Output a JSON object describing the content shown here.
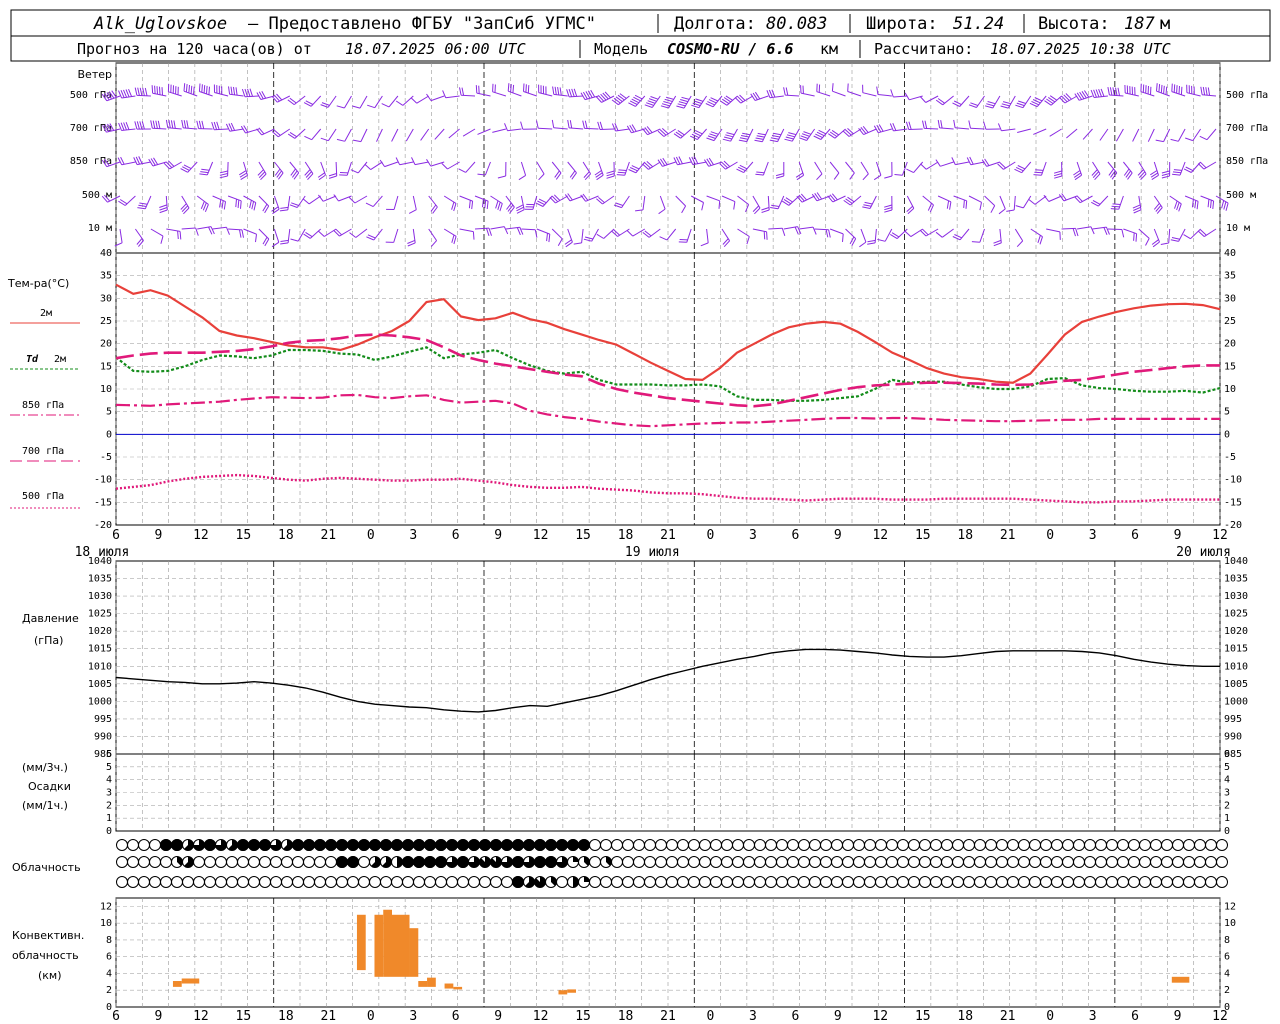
{
  "header": {
    "station": "Alk_Uglovskoe",
    "provider": "– Предоставлено ФГБУ \"ЗапСиб УГМС\"",
    "lon_label": "Долгота:",
    "lon": "80.083",
    "lat_label": "Широта:",
    "lat": "51.24",
    "alt_label": "Высота:",
    "alt": "187",
    "alt_unit": "м",
    "forecast_label": "Прогноз на 120 часа(ов) от",
    "forecast_from": "18.07.2025 06:00 UTC",
    "model_label": "Модель",
    "model": "COSMO-RU / 6.6",
    "model_unit": "км",
    "computed_label": "Рассчитано:",
    "computed": "18.07.2025 10:38 UTC"
  },
  "labels": {
    "wind": "Ветер",
    "levels": [
      "500 гПа",
      "700 гПа",
      "850 гПа",
      "500 м",
      "10 м"
    ],
    "temp": "Тем-ра(°C)",
    "t2m": "2м",
    "td": "Td",
    "td_level": "2м",
    "t850": "850 гПа",
    "t700": "700 гПа",
    "t500": "500 гПа",
    "pressure": "Давление",
    "pressure_unit": "(гПа)",
    "precip_unit3": "(мм/3ч.)",
    "precip": "Осадки",
    "precip_unit1": "(мм/1ч.)",
    "cloud": "Облачность",
    "conv1": "Конвективн.",
    "conv2": "облачность",
    "conv3": "(км)"
  },
  "colors": {
    "t2m": "#e8403a",
    "td": "#138c1a",
    "t850": "#e0197a",
    "wind": "#8a2be2",
    "zero": "#0000cc",
    "pressure": "#000000",
    "conv": "#f0892a"
  },
  "chart_data": {
    "type": "meteogram",
    "x_hours": [
      6,
      9,
      12,
      15,
      18,
      21,
      0,
      3,
      6,
      9,
      12,
      15,
      18,
      21,
      0,
      3,
      6,
      9,
      12,
      15,
      18,
      21,
      0,
      3,
      6,
      9,
      12
    ],
    "day_labels": [
      "18 июля",
      "19 июля",
      "20 июля"
    ],
    "temperature": {
      "ylim": [
        -20,
        40
      ],
      "yticks": [
        40,
        35,
        30,
        25,
        20,
        15,
        10,
        5,
        0,
        -5,
        -10,
        -15,
        -20
      ],
      "series": [
        {
          "name": "2м",
          "values": [
            33,
            31,
            31.8,
            30.6,
            28.2,
            25.8,
            22.8,
            21.8,
            21.2,
            20.4,
            19.6,
            19.2,
            19.2,
            18.6,
            19.8,
            21.4,
            22.8,
            25,
            29.2,
            29.8,
            26,
            25.2,
            25.6,
            26.8,
            25.4,
            24.6,
            23.2,
            22,
            20.8,
            19.8,
            17.8,
            15.8,
            14,
            12.2,
            12,
            14.6,
            18,
            20,
            22,
            23.6,
            24.4,
            24.8,
            24.4,
            22.6,
            20.4,
            18,
            16.4,
            14.6,
            13.4,
            12.6,
            12.2,
            11.6,
            11.4,
            13.4,
            17.6,
            22,
            24.8,
            26,
            27,
            27.8,
            28.4,
            28.7,
            28.8,
            28.5,
            27.6
          ]
        },
        {
          "name": "Td 2м",
          "values": [
            17,
            14,
            13.8,
            14,
            15,
            16.4,
            17.4,
            17.2,
            16.8,
            17.4,
            18.6,
            18.6,
            18.4,
            17.8,
            17.6,
            16.4,
            17.2,
            18.2,
            19.2,
            16.8,
            17.6,
            18,
            18.6,
            16.8,
            15.2,
            14,
            13.4,
            13.8,
            12,
            11,
            11,
            11,
            10.8,
            10.8,
            11,
            10.6,
            8.4,
            7.6,
            7.6,
            7.4,
            7.4,
            7.6,
            8,
            8.4,
            10,
            12,
            11.4,
            11.6,
            11.6,
            11,
            10.4,
            10,
            10,
            10.6,
            12.2,
            12.4,
            10.8,
            10.2,
            10,
            9.6,
            9.4,
            9.4,
            9.6,
            9.2,
            10.2
          ]
        },
        {
          "name": "850 гПа",
          "values": [
            6.5,
            6.4,
            6.3,
            6.6,
            6.8,
            7,
            7.2,
            7.6,
            7.9,
            8.2,
            8.1,
            8,
            8.1,
            8.6,
            8.7,
            8.2,
            8,
            8.4,
            8.6,
            7.6,
            7,
            7.2,
            7.4,
            6.8,
            5.2,
            4.4,
            3.8,
            3.4,
            2.8,
            2.4,
            2,
            1.8,
            2,
            2.2,
            2.4,
            2.5,
            2.6,
            2.6,
            2.8,
            3,
            3.2,
            3.4,
            3.6,
            3.6,
            3.5,
            3.6,
            3.6,
            3.4,
            3.2,
            3.1,
            3,
            2.9,
            2.9,
            3,
            3.1,
            3.2,
            3.2,
            3.4,
            3.4,
            3.4,
            3.4,
            3.4,
            3.4,
            3.4,
            3.4
          ]
        },
        {
          "name": "700 гПа",
          "values": [
            16.8,
            17.4,
            17.8,
            18,
            18,
            18,
            18.2,
            18.4,
            18.8,
            19.4,
            20.2,
            20.6,
            20.8,
            21.2,
            21.8,
            22,
            21.8,
            21.4,
            20.8,
            19.2,
            17.4,
            16.4,
            15.6,
            15,
            14.4,
            13.8,
            13.2,
            12.8,
            11.2,
            10,
            9.2,
            8.6,
            8,
            7.6,
            7.2,
            6.8,
            6.4,
            6.2,
            6.6,
            7.4,
            8.2,
            9,
            9.8,
            10.4,
            10.8,
            11,
            11.2,
            11.4,
            11.4,
            11.3,
            11.2,
            11,
            10.9,
            11,
            11.4,
            11.8,
            12,
            12.6,
            13.2,
            13.8,
            14.2,
            14.6,
            15,
            15.2,
            15.2
          ]
        },
        {
          "name": "500 гПа",
          "values": [
            -12,
            -11.6,
            -11.2,
            -10.4,
            -9.8,
            -9.4,
            -9.2,
            -9,
            -9.2,
            -9.6,
            -10,
            -10.2,
            -9.8,
            -9.6,
            -9.8,
            -10,
            -10.2,
            -10.2,
            -10,
            -10,
            -9.8,
            -10.2,
            -10.6,
            -11.2,
            -11.6,
            -11.8,
            -11.8,
            -11.6,
            -12,
            -12.2,
            -12.4,
            -12.8,
            -13,
            -13,
            -13.2,
            -13.6,
            -14,
            -14.2,
            -14.2,
            -14.4,
            -14.6,
            -14.4,
            -14.2,
            -14.2,
            -14.2,
            -14.4,
            -14.4,
            -14.4,
            -14.2,
            -14.2,
            -14.2,
            -14.2,
            -14.2,
            -14.4,
            -14.6,
            -14.8,
            -15,
            -15,
            -14.8,
            -14.8,
            -14.6,
            -14.4,
            -14.4,
            -14.4,
            -14.4
          ]
        }
      ]
    },
    "pressure": {
      "ylim": [
        985,
        1040
      ],
      "yticks": [
        1040,
        1035,
        1030,
        1025,
        1020,
        1015,
        1010,
        1005,
        1000,
        995,
        990,
        985
      ],
      "values": [
        1006.8,
        1006.4,
        1006,
        1005.6,
        1005.4,
        1005,
        1005,
        1005.2,
        1005.6,
        1005.2,
        1004.6,
        1003.8,
        1002.6,
        1001.2,
        1000,
        999.2,
        998.8,
        998.4,
        998.2,
        997.6,
        997.2,
        997,
        997.4,
        998.2,
        998.8,
        998.6,
        999.6,
        1000.6,
        1001.6,
        1003,
        1004.6,
        1006.2,
        1007.6,
        1008.8,
        1010,
        1011,
        1012,
        1012.8,
        1013.8,
        1014.4,
        1014.8,
        1014.8,
        1014.6,
        1014.2,
        1013.8,
        1013.2,
        1012.8,
        1012.6,
        1012.6,
        1013,
        1013.6,
        1014.2,
        1014.4,
        1014.4,
        1014.4,
        1014.4,
        1014.2,
        1013.8,
        1013,
        1012,
        1011.2,
        1010.6,
        1010.2,
        1010,
        1010
      ]
    },
    "precipitation": {
      "ylim": [
        0,
        6
      ],
      "yticks": [
        6,
        5,
        4,
        3,
        2,
        1,
        0
      ],
      "values": []
    },
    "cloudiness": {
      "rows": [
        [
          0,
          0,
          0,
          0,
          8,
          8,
          5,
          6,
          8,
          6,
          5,
          8,
          8,
          8,
          6,
          5,
          8,
          8,
          8,
          8,
          8,
          8,
          8,
          8,
          8,
          8,
          8,
          8,
          8,
          8,
          8,
          8,
          8,
          8,
          8,
          8,
          8,
          8,
          8,
          8,
          8,
          8,
          8,
          0,
          0,
          0,
          0,
          0,
          0,
          0,
          0,
          0,
          0,
          0,
          0,
          0,
          0,
          0,
          0,
          0,
          0,
          0,
          0,
          0,
          0,
          0,
          0,
          0,
          0,
          0,
          0,
          0,
          0,
          0,
          0,
          0,
          0,
          0,
          0,
          0,
          0,
          0,
          0,
          0,
          0,
          0,
          0,
          0,
          0,
          0,
          0,
          0,
          0,
          0,
          0,
          0,
          0,
          0,
          0,
          0,
          0
        ],
        [
          0,
          0,
          0,
          0,
          0,
          3,
          5,
          0,
          0,
          0,
          0,
          0,
          0,
          0,
          0,
          0,
          0,
          0,
          0,
          0,
          8,
          8,
          0,
          5,
          5,
          4,
          8,
          8,
          8,
          8,
          6,
          8,
          6,
          7,
          7,
          6,
          8,
          6,
          8,
          8,
          6,
          2,
          3,
          0,
          3,
          0,
          0,
          0,
          0,
          0,
          0,
          0,
          0,
          0,
          0,
          0,
          0,
          0,
          0,
          0,
          0,
          0,
          0,
          0,
          0,
          0,
          0,
          0,
          0,
          0,
          0,
          0,
          0,
          0,
          0,
          0,
          0,
          0,
          0,
          0,
          0,
          0,
          0,
          0,
          0,
          0,
          0,
          0,
          0,
          0,
          0,
          0,
          0,
          0,
          0,
          0,
          0,
          0,
          0,
          0,
          0
        ],
        [
          0,
          0,
          0,
          0,
          0,
          0,
          0,
          0,
          0,
          0,
          0,
          0,
          0,
          0,
          0,
          0,
          0,
          0,
          0,
          0,
          0,
          0,
          0,
          0,
          0,
          0,
          0,
          0,
          0,
          0,
          0,
          0,
          0,
          0,
          0,
          0,
          8,
          5,
          7,
          3,
          0,
          4,
          2,
          0,
          0,
          0,
          0,
          0,
          0,
          0,
          0,
          0,
          0,
          0,
          0,
          0,
          0,
          0,
          0,
          0,
          0,
          0,
          0,
          0,
          0,
          0,
          0,
          0,
          0,
          0,
          0,
          0,
          0,
          0,
          0,
          0,
          0,
          0,
          0,
          0,
          0,
          0,
          0,
          0,
          0,
          0,
          0,
          0,
          0,
          0,
          0,
          0,
          0,
          0,
          0,
          0,
          0,
          0,
          0,
          0,
          0
        ]
      ]
    },
    "convective": {
      "ylim": [
        0,
        13
      ],
      "yticks": [
        12,
        10,
        8,
        6,
        4,
        2,
        0
      ],
      "bars": [
        {
          "h0": 6.5,
          "h1": 7.5,
          "base": 2.4,
          "top": 3.1
        },
        {
          "h0": 7.5,
          "h1": 9.5,
          "base": 2.8,
          "top": 3.4
        },
        {
          "h0": 27.5,
          "h1": 28.5,
          "base": 4.4,
          "top": 11.0
        },
        {
          "h0": 29.5,
          "h1": 30.5,
          "base": 3.6,
          "top": 11.0
        },
        {
          "h0": 30.5,
          "h1": 31.5,
          "base": 3.6,
          "top": 11.6
        },
        {
          "h0": 31.5,
          "h1": 33.5,
          "base": 3.6,
          "top": 11.0
        },
        {
          "h0": 33.5,
          "h1": 34.5,
          "base": 3.6,
          "top": 9.4
        },
        {
          "h0": 34.5,
          "h1": 35.5,
          "base": 2.4,
          "top": 3.1
        },
        {
          "h0": 35.5,
          "h1": 36.5,
          "base": 2.4,
          "top": 3.5
        },
        {
          "h0": 37.5,
          "h1": 38.5,
          "base": 2.2,
          "top": 2.8
        },
        {
          "h0": 38.5,
          "h1": 39.5,
          "base": 2.1,
          "top": 2.4
        },
        {
          "h0": 50.5,
          "h1": 51.5,
          "base": 1.5,
          "top": 2.0
        },
        {
          "h0": 51.5,
          "h1": 52.5,
          "base": 1.7,
          "top": 2.1
        },
        {
          "h0": 120.5,
          "h1": 122.5,
          "base": 2.9,
          "top": 3.6
        }
      ]
    },
    "wind": {
      "levels": [
        "500 гПа",
        "700 гПа",
        "850 гПа",
        "500 м",
        "10 м"
      ],
      "kind": "barbs"
    }
  }
}
